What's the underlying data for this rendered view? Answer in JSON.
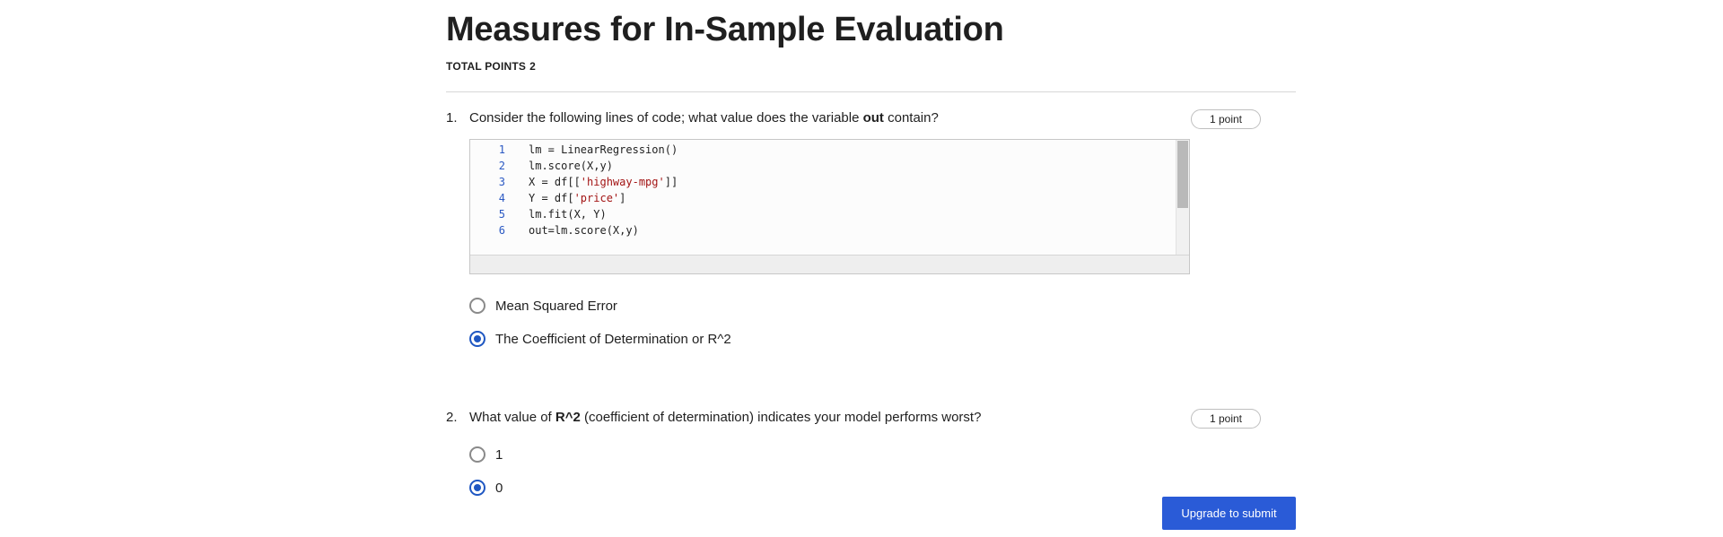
{
  "page": {
    "title": "Measures for In-Sample Evaluation",
    "total_label": "TOTAL POINTS",
    "total_value": "2"
  },
  "questions": [
    {
      "number": "1.",
      "text_before": "Consider the following lines of code; what value does the variable ",
      "text_bold": "out",
      "text_after": " contain?",
      "points": "1 point",
      "code": [
        {
          "ln": "1",
          "pre": "lm = LinearRegression()",
          "str": "",
          "post": ""
        },
        {
          "ln": "2",
          "pre": "lm.score(X,y)",
          "str": "",
          "post": ""
        },
        {
          "ln": "3",
          "pre": "X = df[[",
          "str": "'highway-mpg'",
          "post": "]]"
        },
        {
          "ln": "4",
          "pre": "Y = df[",
          "str": "'price'",
          "post": "]"
        },
        {
          "ln": "5",
          "pre": "lm.fit(X, Y)",
          "str": "",
          "post": ""
        },
        {
          "ln": "6",
          "pre": "out=lm.score(X,y)",
          "str": "",
          "post": ""
        }
      ],
      "options": [
        {
          "label": "Mean Squared Error",
          "selected": false
        },
        {
          "label": "The Coefficient of Determination or R^2",
          "selected": true
        }
      ]
    },
    {
      "number": "2.",
      "text_before": "What value of ",
      "text_bold": "R^2",
      "text_after": " (coefficient of determination) indicates your model performs worst?",
      "points": "1 point",
      "options": [
        {
          "label": "1",
          "selected": false
        },
        {
          "label": "0",
          "selected": true
        }
      ]
    }
  ],
  "submit_label": "Upgrade to submit",
  "colors": {
    "accent": "#1f57c2",
    "button": "#2a5bd7",
    "code_string": "#a31515",
    "line_number": "#2b59c3"
  }
}
